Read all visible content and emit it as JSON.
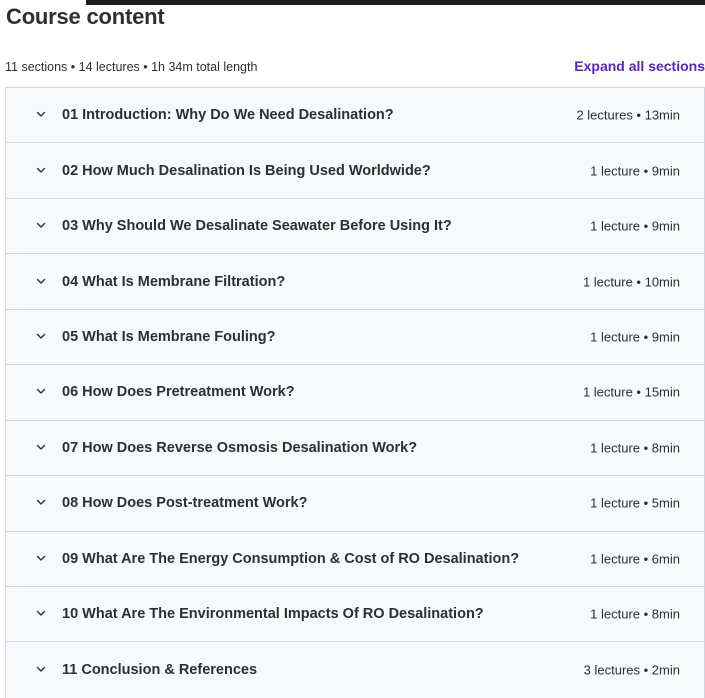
{
  "header": {
    "title": "Course content",
    "summary": "11 sections • 14 lectures • 1h 34m total length",
    "expand_label": "Expand all sections"
  },
  "sections": [
    {
      "title": "01 Introduction: Why Do We Need Desalination?",
      "meta": "2 lectures • 13min"
    },
    {
      "title": "02 How Much Desalination Is Being Used Worldwide?",
      "meta": "1 lecture • 9min"
    },
    {
      "title": "03 Why Should We Desalinate Seawater Before Using It?",
      "meta": "1 lecture • 9min"
    },
    {
      "title": "04 What Is Membrane Filtration?",
      "meta": "1 lecture • 10min"
    },
    {
      "title": "05 What Is Membrane Fouling?",
      "meta": "1 lecture • 9min"
    },
    {
      "title": "06 How Does Pretreatment Work?",
      "meta": "1 lecture • 15min"
    },
    {
      "title": "07 How Does Reverse Osmosis Desalination Work?",
      "meta": "1 lecture • 8min"
    },
    {
      "title": "08 How Does Post-treatment Work?",
      "meta": "1 lecture • 5min"
    },
    {
      "title": "09 What Are The Energy Consumption & Cost of RO Desalination?",
      "meta": "1 lecture • 6min"
    },
    {
      "title": "10 What Are The Environmental Impacts Of RO Desalination?",
      "meta": "1 lecture • 8min"
    },
    {
      "title": "11 Conclusion & References",
      "meta": "3 lectures • 2min"
    }
  ],
  "icons": {
    "section_toggle": "chevron-down-icon"
  },
  "colors": {
    "accent": "#5624d0",
    "text": "#2d2f31",
    "section_bg": "#f7f9fa",
    "border": "#d1d7dc"
  }
}
